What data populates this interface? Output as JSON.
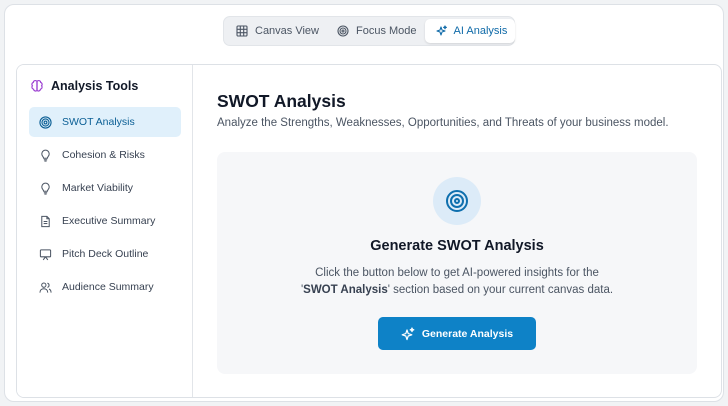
{
  "view_switcher": {
    "items": [
      {
        "label": "Canvas View",
        "icon": "grid-icon"
      },
      {
        "label": "Focus Mode",
        "icon": "target-icon"
      },
      {
        "label": "AI Analysis",
        "icon": "sparkles-icon",
        "active": true
      }
    ]
  },
  "sidebar": {
    "title": "Analysis Tools",
    "title_icon": "brain-icon",
    "items": [
      {
        "label": "SWOT Analysis",
        "icon": "target-icon",
        "active": true
      },
      {
        "label": "Cohesion & Risks",
        "icon": "lightbulb-icon"
      },
      {
        "label": "Market Viability",
        "icon": "lightbulb-icon"
      },
      {
        "label": "Executive Summary",
        "icon": "document-icon"
      },
      {
        "label": "Pitch Deck Outline",
        "icon": "presentation-icon"
      },
      {
        "label": "Audience Summary",
        "icon": "users-icon"
      }
    ]
  },
  "main": {
    "title": "SWOT Analysis",
    "subtitle": "Analyze the Strengths, Weaknesses, Opportunities, and Threats of your business model.",
    "card": {
      "icon": "target-icon",
      "title": "Generate SWOT Analysis",
      "desc_line1": "Click the button below to get AI-powered insights for the",
      "desc_quote_open": "'",
      "desc_section": "SWOT Analysis",
      "desc_rest": "' section based on your current canvas data.",
      "button_label": "Generate Analysis"
    }
  },
  "colors": {
    "accent": "#0e82c7",
    "active_bg": "#e0f0fb",
    "brain_icon": "#9b3fd1"
  }
}
